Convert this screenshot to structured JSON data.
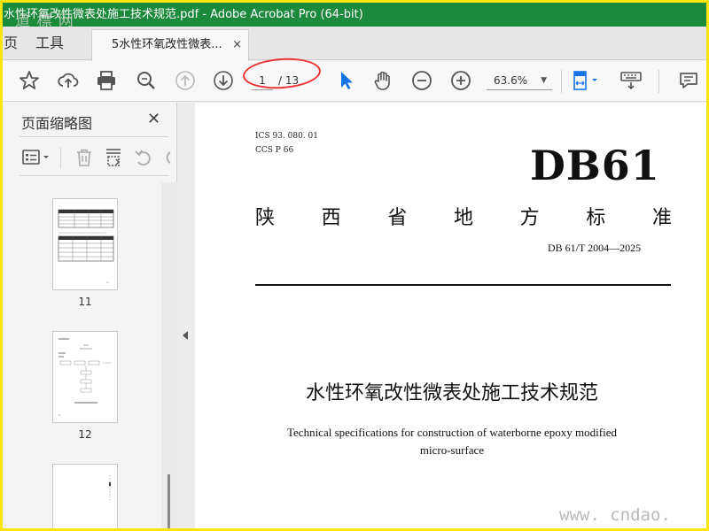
{
  "window": {
    "title": "水性环氧改性微表处施工技术规范.pdf - Adobe Acrobat Pro (64-bit)",
    "watermark": "道 標 网"
  },
  "tabs": {
    "home_label": "页",
    "tools_label": "工具",
    "doc_label": "5水性环氧改性微表...",
    "close_glyph": "×"
  },
  "toolbar": {
    "current_page": "1",
    "total_pages": "/ 13",
    "zoom": "63.6%",
    "icons": [
      "star-icon",
      "upload-icon",
      "print-icon",
      "zoom-search-icon",
      "page-up-icon",
      "page-down-icon",
      "select-arrow-icon",
      "hand-icon",
      "zoom-out-icon",
      "zoom-in-icon",
      "fit-page-icon",
      "keyboard-icon",
      "comment-icon"
    ]
  },
  "sidebar": {
    "title": "页面缩略图",
    "close_glyph": "✕",
    "thumbnails": [
      {
        "label": "11"
      },
      {
        "label": "12"
      },
      {
        "label": ""
      }
    ]
  },
  "document": {
    "ics": "ICS  93. 080. 01",
    "ccs": "CCS P 66",
    "code": "DB61",
    "standard_chars": [
      "陕",
      "西",
      "省",
      "地",
      "方",
      "标",
      "准"
    ],
    "standard_number": "DB 61/T  2004—2025",
    "title_cn": "水性环氧改性微表处施工技术规范",
    "title_en_line1": "Technical specifications for construction of waterborne epoxy modified",
    "title_en_line2": "micro-surface",
    "watermark": "www. cndao. com"
  },
  "colors": {
    "titlebar": "#1c8a3b",
    "frame_border": "#ffe600",
    "annotation_circle": "#e33333",
    "select_tool": "#1473e6"
  }
}
